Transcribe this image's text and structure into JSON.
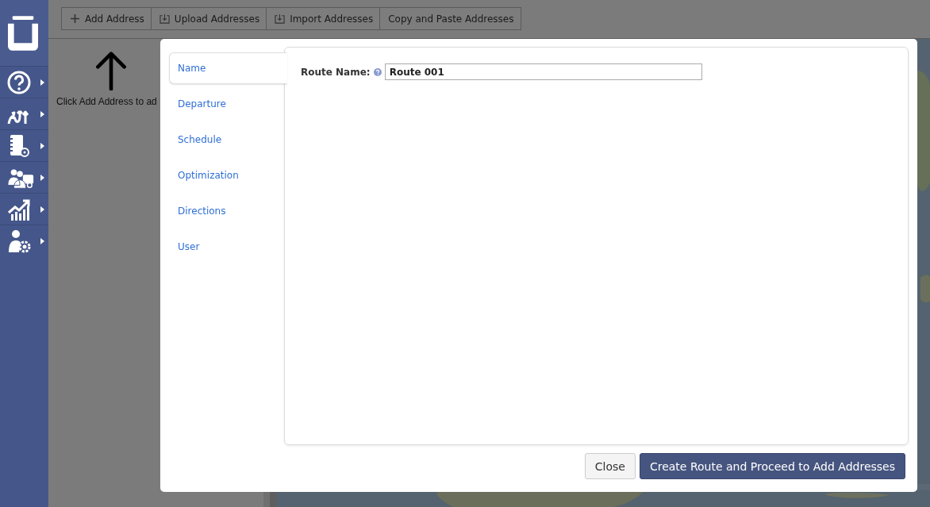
{
  "toolbar": [
    {
      "label": "Add Address",
      "kind": "plus"
    },
    {
      "label": "Upload Addresses",
      "kind": "upload"
    },
    {
      "label": "Import Addresses",
      "kind": "import"
    },
    {
      "label": "Copy and Paste Addresses",
      "kind": "none"
    }
  ],
  "hint": "Click Add Address to ad",
  "dialog": {
    "tabs": [
      {
        "label": "Name",
        "selected": true
      },
      {
        "label": "Departure",
        "selected": false
      },
      {
        "label": "Schedule",
        "selected": false
      },
      {
        "label": "Optimization",
        "selected": false
      },
      {
        "label": "Directions",
        "selected": false
      },
      {
        "label": "User",
        "selected": false
      }
    ],
    "field": {
      "label": "Route Name:",
      "value": "Route 001"
    },
    "buttons": [
      {
        "label": "Close",
        "kind": "secondary"
      },
      {
        "label": "Create Route and Proceed to Add Addresses",
        "kind": "primary"
      }
    ]
  }
}
